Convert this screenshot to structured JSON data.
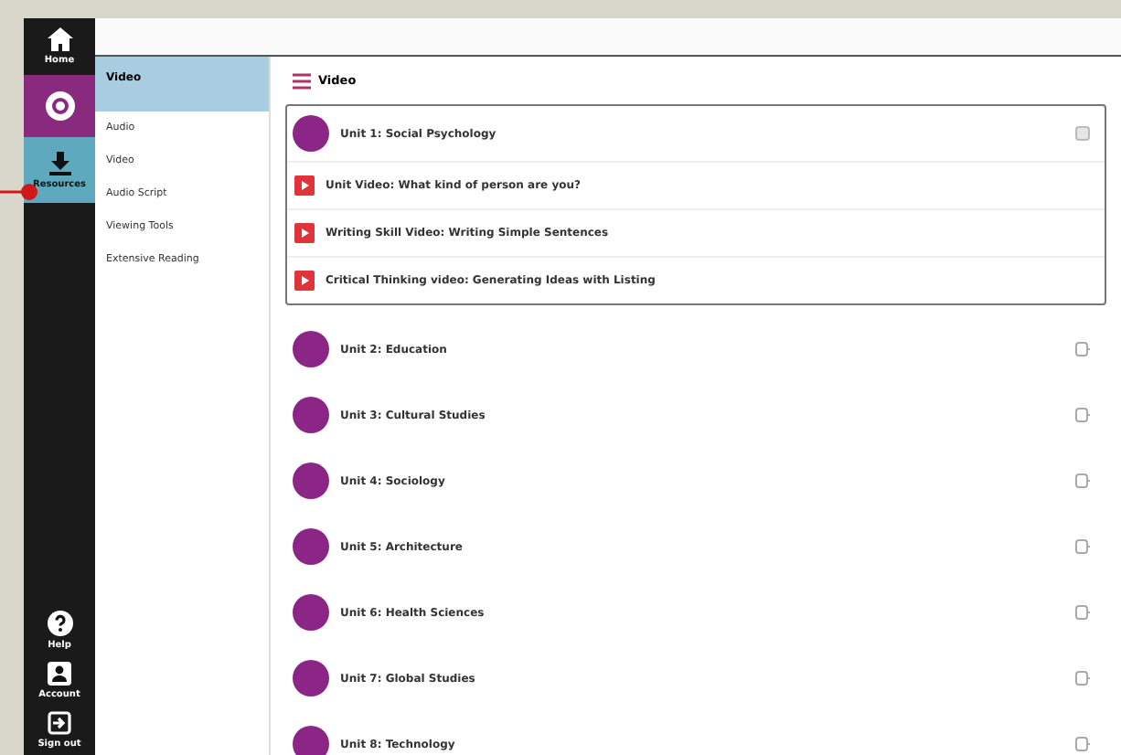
{
  "nav": [
    {
      "label": "Home",
      "selected": false
    },
    {
      "selected": false
    },
    {
      "label": "Resources",
      "selected": true
    }
  ],
  "nav_bottom": [
    {
      "label": "Help"
    },
    {
      "label": "Account"
    },
    {
      "label": "Sign out"
    }
  ],
  "subnav": {
    "header": "Video",
    "items": [
      {
        "label": "Audio",
        "selected": false
      },
      {
        "label": "Video",
        "selected": false
      },
      {
        "label": "Audio Script",
        "selected": false
      },
      {
        "label": "Viewing Tools",
        "selected": false
      },
      {
        "label": "Extensive Reading",
        "selected": false
      }
    ]
  },
  "section_title": "Video",
  "units": [
    {
      "title": "Unit 1: Social Psychology",
      "expanded": true,
      "videos": [
        "Unit Video: What kind of person are you?",
        "Writing Skill Video: Writing Simple Sentences",
        "Critical Thinking video: Generating Ideas with Listing"
      ]
    },
    {
      "title": "Unit 2: Education",
      "expanded": false
    },
    {
      "title": "Unit 3: Cultural Studies",
      "expanded": false
    },
    {
      "title": "Unit 4: Sociology",
      "expanded": false
    },
    {
      "title": "Unit 5: Architecture",
      "expanded": false
    },
    {
      "title": "Unit 6: Health Sciences",
      "expanded": false
    },
    {
      "title": "Unit 7: Global Studies",
      "expanded": false
    },
    {
      "title": "Unit 8: Technology",
      "expanded": false
    }
  ]
}
